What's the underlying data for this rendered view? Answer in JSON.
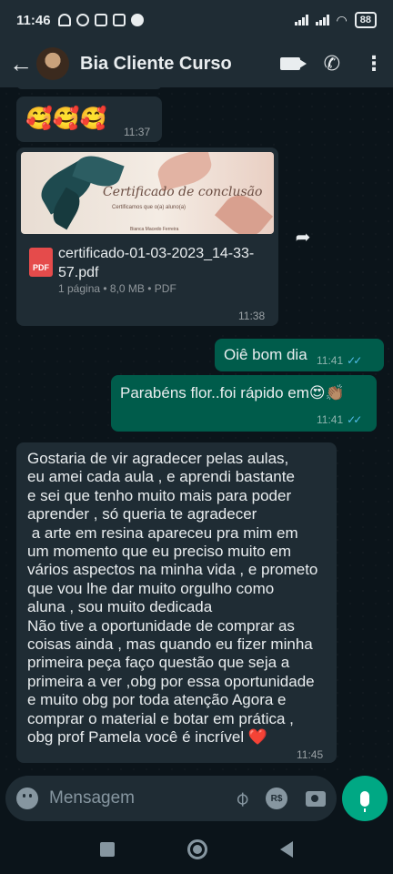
{
  "status_bar": {
    "time": "11:46",
    "battery": "88"
  },
  "header": {
    "contact_name": "Bia Cliente Curso",
    "back_icon": "arrow-left-icon",
    "video_icon": "video-call-icon",
    "call_icon": "phone-icon",
    "menu_icon": "more-vertical-icon"
  },
  "messages": {
    "emoji_msg": {
      "text": "🥰🥰🥰",
      "time": "11:37"
    },
    "document": {
      "preview_title": "Certificado de conclusão",
      "preview_subtitle": "Certificamos que o(a) aluno(a)",
      "preview_signature": "Bianca Macedo Ferreira",
      "file_icon_label": "PDF",
      "file_name": "certificado-01-03-2023_14-33-57.pdf",
      "meta": "1 página • 8,0 MB • PDF",
      "time": "11:38"
    },
    "out1": {
      "text": "Oiê bom dia",
      "time": "11:41"
    },
    "out2": {
      "text": "Parabéns flor..foi rápido em😍👏🏽",
      "time": "11:41"
    },
    "long": {
      "text": "Gostaria de vir agradecer pelas aulas,\neu amei cada aula , e aprendi bastante\ne sei que tenho muito mais para poder\naprender , só queria te agradecer\n a arte em resina apareceu pra mim em\num momento que eu preciso muito em\nvários aspectos na minha vida , e prometo\nque vou lhe dar muito orgulho como\naluna , sou muito dedicada\nNão tive a oportunidade de comprar as\ncoisas ainda , mas quando eu fizer minha\nprimeira peça faço questão que seja a\nprimeira a ver ,obg por essa oportunidade\ne muito obg por toda atenção Agora e\ncomprar o material e botar em prática ,\nobg prof Pamela você é incrível ❤️",
      "time": "11:45"
    }
  },
  "composer": {
    "placeholder": "Mensagem",
    "currency_label": "R$"
  },
  "colors": {
    "header_bg": "#1f2c34",
    "chat_bg": "#0b141a",
    "outgoing_bubble": "#005c4b",
    "incoming_bubble": "#1f2c34",
    "accent": "#00a884",
    "read_ticks": "#53bdeb"
  }
}
